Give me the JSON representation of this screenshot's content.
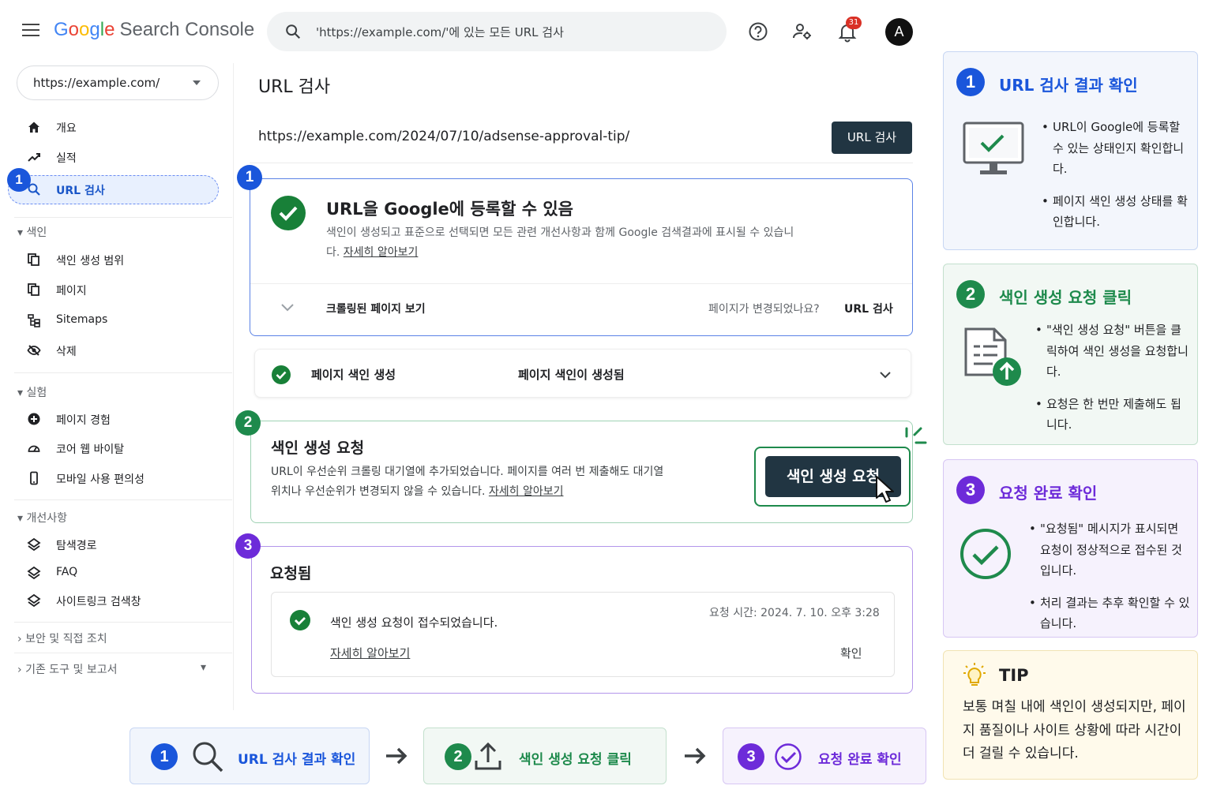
{
  "header": {
    "logo_google": [
      "G",
      "o",
      "o",
      "g",
      "l",
      "e"
    ],
    "product": "Search Console",
    "search_placeholder": "'https://example.com/'에 있는 모든 URL 검사",
    "notification_count": "31",
    "avatar_letter": "A",
    "icons": [
      "menu-icon",
      "search-icon",
      "help-icon",
      "manage-users-icon",
      "bell-icon"
    ]
  },
  "sidebar": {
    "property": "https://example.com/",
    "items": [
      {
        "label": "개요",
        "icon": "home-icon"
      },
      {
        "label": "실적",
        "icon": "trending-icon"
      },
      {
        "label": "URL 검사",
        "icon": "search-icon",
        "active": true
      }
    ],
    "sections": [
      {
        "title": "색인",
        "items": [
          {
            "label": "색인 생성 범위",
            "icon": "copy-icon"
          },
          {
            "label": "페이지",
            "icon": "copy-icon"
          },
          {
            "label": "Sitemaps",
            "icon": "sitemap-icon"
          },
          {
            "label": "삭제",
            "icon": "hide-icon"
          }
        ]
      },
      {
        "title": "실험",
        "items": [
          {
            "label": "페이지 경험",
            "icon": "plus-circle-icon"
          },
          {
            "label": "코어 웹 바이탈",
            "icon": "gauge-icon"
          },
          {
            "label": "모바일 사용 편의성",
            "icon": "phone-icon"
          }
        ]
      },
      {
        "title": "개선사항",
        "items": [
          {
            "label": "탐색경로",
            "icon": "layers-icon"
          },
          {
            "label": "FAQ",
            "icon": "layers-icon"
          },
          {
            "label": "사이트링크 검색창",
            "icon": "layers-icon"
          }
        ]
      }
    ],
    "collapsed": [
      "보안 및 직접 조치",
      "기존 도구 및 보고서"
    ]
  },
  "main": {
    "title": "URL 검사",
    "inspected_url": "https://example.com/2024/07/10/adsense-approval-tip/",
    "inspect_button": "URL 검사",
    "status_card": {
      "title": "URL을 Google에 등록할 수 있음",
      "desc": "색인이 생성되고 표준으로 선택되면 모든 관련 개선사항과 함께 Google 검색결과에 표시될 수 있습니다. ",
      "link": "자세히 알아보기",
      "crawled": "크롤링된 페이지 보기",
      "changed_q": "페이지가 변경되었나요?",
      "changed_action": "URL 검사"
    },
    "index_card": {
      "label": "페이지 색인 생성",
      "value": "페이지 색인이 생성됨"
    },
    "request_card": {
      "title": "색인 생성 요청",
      "desc": "URL이 우선순위 크롤링 대기열에 추가되었습니다. 페이지를 여러 번 제출해도 대기열 위치나 우선순위가 변경되지 않을 수 있습니다. ",
      "link": "자세히 알아보기",
      "button": "색인 생성 요청"
    },
    "requested_card": {
      "title": "요청됨",
      "message": "색인 생성 요청이 접수되었습니다.",
      "time": "요청 시간: 2024. 7. 10. 오후 3:28",
      "link": "자세히 알아보기",
      "ok": "확인"
    },
    "step_numbers": [
      "1",
      "2",
      "3"
    ]
  },
  "guide": {
    "steps": [
      {
        "num": "1",
        "title": "URL 검사 결과 확인",
        "bullets": [
          "URL이 Google에 등록할 수 있는 상태인지 확인합니다.",
          "페이지 색인 생성 상태를 확인합니다."
        ],
        "icon": "monitor-check-icon"
      },
      {
        "num": "2",
        "title": "색인 생성 요청 클릭",
        "bullets": [
          "\"색인 생성 요청\" 버튼을 클릭하여 색인 생성을 요청합니다.",
          "요청은 한 번만 제출해도 됩니다."
        ],
        "icon": "document-upload-icon"
      },
      {
        "num": "3",
        "title": "요청 완료 확인",
        "bullets": [
          "\"요청됨\" 메시지가 표시되면 요청이 정상적으로 접수된 것입니다.",
          "처리 결과는 추후 확인할 수 있습니다."
        ],
        "icon": "check-circle-icon"
      }
    ],
    "tip": {
      "title": "TIP",
      "text": "보통 며칠 내에 색인이 생성되지만, 페이지 품질이나 사이트 상황에 따라 시간이 더 걸릴 수 있습니다.",
      "icon": "lightbulb-icon"
    }
  },
  "flow": [
    {
      "num": "1",
      "label": "URL 검사 결과 확인",
      "icon": "search-icon"
    },
    {
      "num": "2",
      "label": "색인 생성 요청 클릭",
      "icon": "upload-icon"
    },
    {
      "num": "3",
      "label": "요청 완료 확인",
      "icon": "check-circle-icon"
    }
  ],
  "colors": {
    "blue": "#1a56db",
    "green": "#1e8a4c",
    "purple": "#6d2bd9",
    "dark_button": "#213542"
  }
}
